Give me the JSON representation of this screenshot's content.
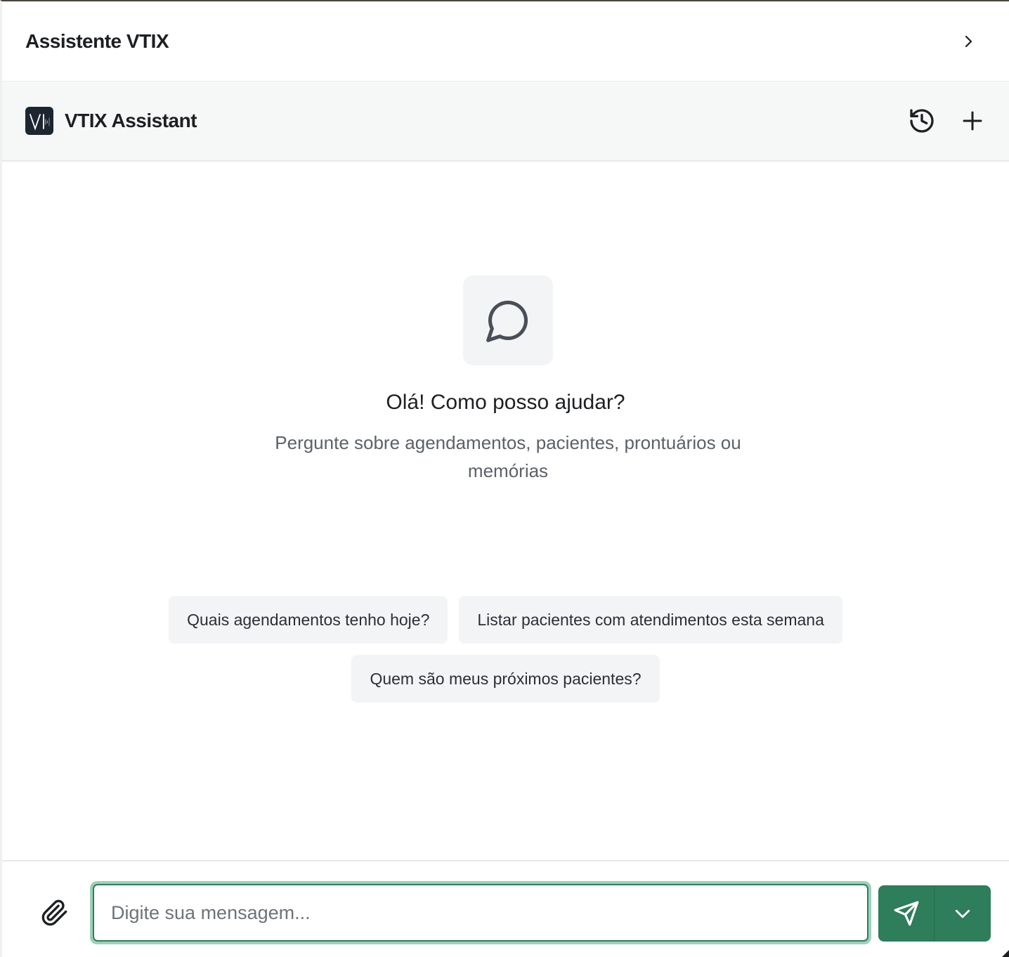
{
  "header": {
    "title": "Assistente VTIX",
    "collapse_icon": "chevron-right-icon"
  },
  "assistant_bar": {
    "logo_icon": "vtix-logo",
    "name": "VTIX Assistant",
    "history_icon": "history-icon",
    "new_chat_icon": "plus-icon"
  },
  "empty_state": {
    "icon": "message-circle-icon",
    "greeting": "Olá! Como posso ajudar?",
    "subtitle": "Pergunte sobre agendamentos, pacientes, prontuários ou memórias"
  },
  "suggestions": [
    "Quais agendamentos tenho hoje?",
    "Listar pacientes com atendimentos esta semana",
    "Quem são meus próximos pacientes?"
  ],
  "composer": {
    "attach_icon": "paperclip-icon",
    "placeholder": "Digite sua mensagem...",
    "value": "",
    "send_icon": "send-icon",
    "options_icon": "chevron-down-icon"
  },
  "colors": {
    "accent": "#2e7d5b",
    "focus_ring": "#9dd0bc",
    "logo_bg": "#1c2530"
  }
}
